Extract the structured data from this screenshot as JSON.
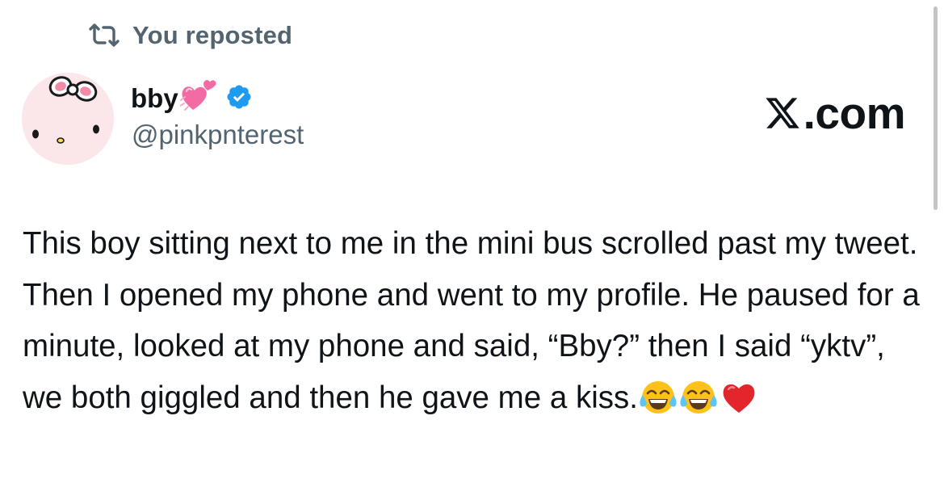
{
  "repost": {
    "icon": "repost-icon",
    "label": "You reposted"
  },
  "author": {
    "avatar": "hello-kitty-avatar",
    "display_name": "bby",
    "name_emoji": "pink-hearts-emoji",
    "verified_icon": "verified-badge-icon",
    "verified_color": "#1d9bf0",
    "handle": "@pinkpnterest"
  },
  "brand": {
    "logo_icon": "x-logo-icon",
    "suffix": ".com"
  },
  "tweet": {
    "text": "This boy sitting next to me in the mini bus scrolled past my tweet. Then I opened my phone and went to my profile. He paused for a minute, looked at my phone and said, “Bby?” then I said “yktv”, we both giggled and then he gave me a kiss.",
    "emojis": [
      "tears-of-joy-emoji",
      "tears-of-joy-emoji",
      "red-heart-emoji"
    ]
  },
  "colors": {
    "primary_text": "#0f1419",
    "secondary_text": "#536471",
    "background": "#ffffff"
  }
}
